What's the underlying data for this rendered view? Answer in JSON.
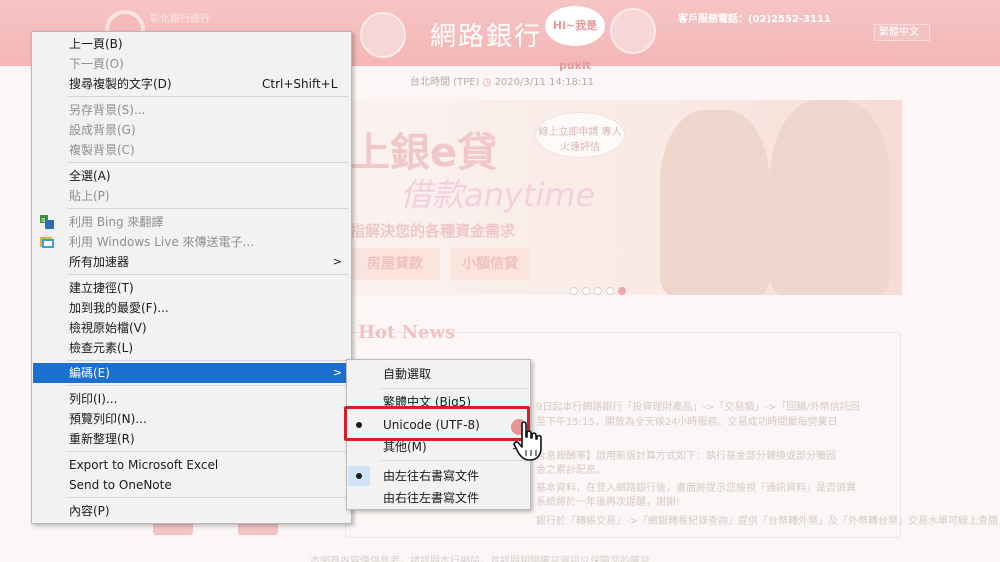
{
  "background": {
    "bank_tagline": "彰化銀行總行",
    "bank_title": "網路銀行",
    "bubble_text": "Hi~我是 pukit",
    "service_phone": "客戶服務電話：(02)2552-3111",
    "language_select": "繁體中文",
    "time_label": "台北時間 (TPE)",
    "time_value": "2020/3/11 14:18:11",
    "hero_title": "上銀e貸",
    "hero_subtitle": "借款anytime",
    "hero_tagline": "指解決您的各種資金需求",
    "hero_note": "線上立即申請 專人火速評估",
    "hero_button_1": "房屋貸款",
    "hero_button_2": "小額信貸",
    "hot_news_title": "Hot News",
    "news_lines": [
      "9日起本行網路銀行「投資理財產品」->「交易類」->「回饋/外幣信託回",
      "至下午15:15，開放為全天候24小時服務。交易成功時間屬每營業日",
      "含息報酬率】啟用新版計算方式如下：執行基金部分轉換或部分贖回",
      "金之累計配息。",
      "基本資料，在登入網路銀行後，畫面將提示您檢視「通訊資料」是否須異",
      "系統將於一年後再次提醒，謝謝!",
      "銀行於「轉帳交易」->「網銀轉帳紀錄查詢」提供「台幣轉外幣」及「外幣轉台幣」交易水單可線上查閱，歡"
    ],
    "footer_text": "本網頁內容僅供參考，請詳閱本行網站，並詳閱相關權益資訊以保障您的權益"
  },
  "context_menu": {
    "items": [
      {
        "label": "上一頁(B)",
        "disabled": false
      },
      {
        "label": "下一頁(O)",
        "disabled": true
      },
      {
        "label": "搜尋複製的文字(D)",
        "shortcut": "Ctrl+Shift+L",
        "disabled": false
      },
      {
        "label": "另存背景(S)...",
        "disabled": true
      },
      {
        "label": "設成背景(G)",
        "disabled": true
      },
      {
        "label": "複製背景(C)",
        "disabled": true
      },
      {
        "label": "全選(A)",
        "disabled": false
      },
      {
        "label": "貼上(P)",
        "disabled": true
      },
      {
        "label": "利用 Bing 來翻譯",
        "disabled": true
      },
      {
        "label": "利用 Windows Live 來傳送電子...",
        "disabled": true
      },
      {
        "label": "所有加速器",
        "disabled": false
      },
      {
        "label": "建立捷徑(T)",
        "disabled": false
      },
      {
        "label": "加到我的最愛(F)...",
        "disabled": false
      },
      {
        "label": "檢視原始檔(V)",
        "disabled": false
      },
      {
        "label": "檢查元素(L)",
        "disabled": false
      },
      {
        "label": "編碼(E)",
        "disabled": false
      },
      {
        "label": "列印(I)...",
        "disabled": false
      },
      {
        "label": "預覽列印(N)...",
        "disabled": false
      },
      {
        "label": "重新整理(R)",
        "disabled": false
      },
      {
        "label": "Export to Microsoft Excel",
        "disabled": false
      },
      {
        "label": "Send to OneNote",
        "disabled": false
      },
      {
        "label": "內容(P)",
        "disabled": false
      }
    ],
    "submenu_arrow": ">"
  },
  "encoding_submenu": {
    "items": [
      {
        "label": "自動選取"
      },
      {
        "label": "繁體中文 (Big5)"
      },
      {
        "label": "Unicode (UTF-8)",
        "selected": true
      },
      {
        "label": "其他(M)"
      },
      {
        "label": "由左往右書寫文件",
        "selected": true
      },
      {
        "label": "由右往左書寫文件"
      }
    ],
    "submenu_arrow": ">"
  },
  "colors": {
    "menu_highlight": "#1b6fd1",
    "annotation_red": "#d81d28",
    "banner_pink": "#f4b6b6"
  }
}
